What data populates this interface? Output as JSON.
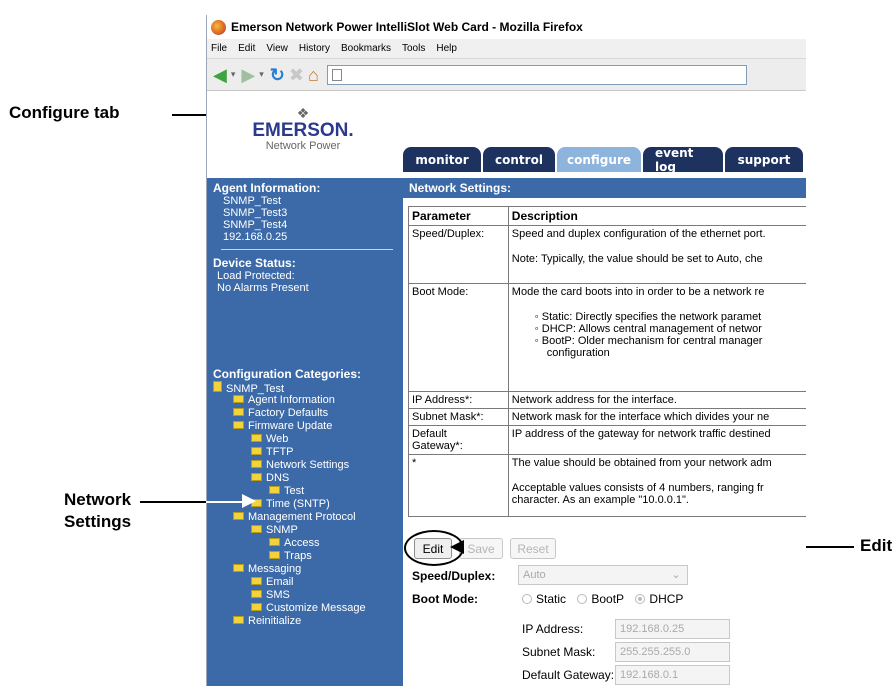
{
  "browser": {
    "title": "Emerson Network Power IntelliSlot Web Card - Mozilla Firefox",
    "menu": [
      "File",
      "Edit",
      "View",
      "History",
      "Bookmarks",
      "Tools",
      "Help"
    ]
  },
  "logo": {
    "brand": "EMERSON.",
    "sub": "Network Power"
  },
  "tabs": [
    "monitor",
    "control",
    "configure",
    "event log",
    "support"
  ],
  "sidebar": {
    "agent_header": "Agent Information:",
    "agent_items": [
      "SNMP_Test",
      "SNMP_Test3",
      "SNMP_Test4",
      "192.168.0.25"
    ],
    "device_header": "Device Status:",
    "device_items": [
      "Load Protected:",
      "No Alarms Present"
    ],
    "config_header": "Configuration Categories:",
    "tree": [
      "SNMP_Test",
      "Agent Information",
      "Factory Defaults",
      "Firmware Update",
      "Web",
      "TFTP",
      "Network Settings",
      "DNS",
      "Test",
      "Time (SNTP)",
      "Management Protocol",
      "SNMP",
      "Access",
      "Traps",
      "Messaging",
      "Email",
      "SMS",
      "Customize Message",
      "Reinitialize"
    ]
  },
  "main": {
    "header": "Network Settings:",
    "table": {
      "col_param": "Parameter",
      "col_desc": "Description",
      "speed_param": "Speed/Duplex:",
      "speed_desc1": "Speed and duplex configuration of the ethernet port.",
      "speed_desc2": "Note: Typically, the value should be set to Auto, che",
      "boot_param": "Boot Mode:",
      "boot_desc": "Mode the card boots into in order to be a network re",
      "boot_static": "Static: Directly specifies the network paramet",
      "boot_dhcp": "DHCP: Allows central management of networ",
      "boot_bootp1": "BootP: Older mechanism for central manager",
      "boot_bootp2": "configuration",
      "ip_param": "IP Address*:",
      "ip_desc": "Network address for the interface.",
      "mask_param": "Subnet Mask*:",
      "mask_desc": "Network mask for the interface which divides your ne",
      "gw_param1": "Default",
      "gw_param2": "Gateway*:",
      "gw_desc": "IP address of the gateway for network traffic destined",
      "star_param": "*",
      "star_desc1": "The value should be obtained from your network adm",
      "star_desc2": "Acceptable values consists of 4 numbers, ranging fr",
      "star_desc3": "character. As an example \"10.0.0.1\"."
    },
    "buttons": {
      "edit": "Edit",
      "save": "Save",
      "reset": "Reset"
    },
    "form": {
      "speed_label": "Speed/Duplex:",
      "speed_value": "Auto",
      "boot_label": "Boot Mode:",
      "opt_static": "Static",
      "opt_bootp": "BootP",
      "opt_dhcp": "DHCP",
      "ip_label": "IP Address:",
      "ip_value": "192.168.0.25",
      "mask_label": "Subnet Mask:",
      "mask_value": "255.255.255.0",
      "gw_label": "Default Gateway:",
      "gw_value": "192.168.0.1"
    }
  },
  "callouts": {
    "configure": "Configure tab",
    "network1": "Network",
    "network2": "Settings",
    "edit": "Edit"
  }
}
